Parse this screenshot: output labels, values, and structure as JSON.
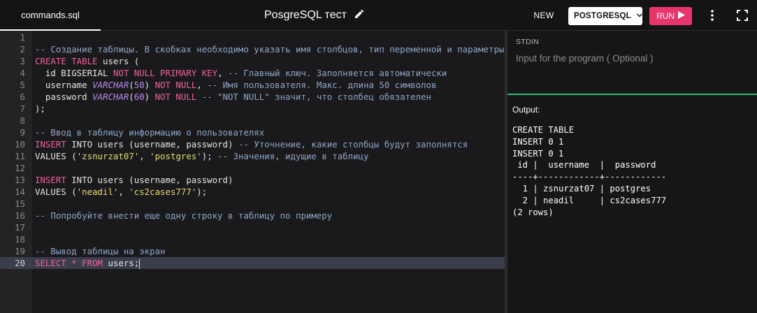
{
  "tab": {
    "label": "commands.sql"
  },
  "header": {
    "title": "PosgreSQL тест"
  },
  "toolbar": {
    "new_label": "NEW",
    "language": "POSTGRESQL",
    "run_label": "RUN"
  },
  "colors": {
    "run_button": "#e6366c",
    "divider_accent": "#2fbf7a",
    "active_line": "#3a3d4a"
  },
  "stdin": {
    "label": "STDIN",
    "placeholder": "Input for the program ( Optional )"
  },
  "output": {
    "label": "Output:",
    "text": "CREATE TABLE\nINSERT 0 1\nINSERT 0 1\n id |  username  |  password  \n----+------------+------------\n  1 | zsnurzat07 | postgres\n  2 | neadil     | cs2cases777\n(2 rows)"
  },
  "editor": {
    "active_line": 20,
    "lines": [
      {
        "n": "1",
        "tokens": []
      },
      {
        "n": "2",
        "tokens": [
          {
            "t": "-- Создание таблицы. В скобках необходимо указать имя столбцов, тип переменной и параметры",
            "c": "cm"
          }
        ]
      },
      {
        "n": "3",
        "tokens": [
          {
            "t": "CREATE TABLE",
            "c": "kw"
          },
          {
            "t": " users (",
            "c": ""
          }
        ]
      },
      {
        "n": "4",
        "tokens": [
          {
            "t": "  id BIGSERIAL ",
            "c": ""
          },
          {
            "t": "NOT NULL PRIMARY KEY",
            "c": "kw"
          },
          {
            "t": ", ",
            "c": ""
          },
          {
            "t": "-- Главный ключ. Заполняется автоматически",
            "c": "cm"
          }
        ]
      },
      {
        "n": "5",
        "tokens": [
          {
            "t": "  username ",
            "c": ""
          },
          {
            "t": "VARCHAR",
            "c": "ty"
          },
          {
            "t": "(",
            "c": ""
          },
          {
            "t": "50",
            "c": "num"
          },
          {
            "t": ") ",
            "c": ""
          },
          {
            "t": "NOT NULL",
            "c": "kw"
          },
          {
            "t": ", ",
            "c": ""
          },
          {
            "t": "-- Имя пользователя. Макс. длина 50 символов",
            "c": "cm"
          }
        ]
      },
      {
        "n": "6",
        "tokens": [
          {
            "t": "  password ",
            "c": ""
          },
          {
            "t": "VARCHAR",
            "c": "ty"
          },
          {
            "t": "(",
            "c": ""
          },
          {
            "t": "60",
            "c": "num"
          },
          {
            "t": ") ",
            "c": ""
          },
          {
            "t": "NOT NULL",
            "c": "kw"
          },
          {
            "t": " ",
            "c": ""
          },
          {
            "t": "-- \"NOT NULL\" значит, что столбец обязателен",
            "c": "cm"
          }
        ]
      },
      {
        "n": "7",
        "tokens": [
          {
            "t": ");",
            "c": ""
          }
        ]
      },
      {
        "n": "8",
        "tokens": []
      },
      {
        "n": "9",
        "tokens": [
          {
            "t": "-- Ввод в таблицу информацию о пользователях",
            "c": "cm"
          }
        ]
      },
      {
        "n": "10",
        "tokens": [
          {
            "t": "INSERT",
            "c": "kw"
          },
          {
            "t": " INTO users (username, password) ",
            "c": ""
          },
          {
            "t": "-- Уточнение, какие столбцы будут заполнятся",
            "c": "cm"
          }
        ]
      },
      {
        "n": "11",
        "tokens": [
          {
            "t": "VALUES (",
            "c": ""
          },
          {
            "t": "'zsnurzat07'",
            "c": "str"
          },
          {
            "t": ", ",
            "c": ""
          },
          {
            "t": "'postgres'",
            "c": "str"
          },
          {
            "t": "); ",
            "c": ""
          },
          {
            "t": "-- Значения, идущие в таблицу",
            "c": "cm"
          }
        ]
      },
      {
        "n": "12",
        "tokens": []
      },
      {
        "n": "13",
        "tokens": [
          {
            "t": "INSERT",
            "c": "kw"
          },
          {
            "t": " INTO users (username, password)",
            "c": ""
          }
        ]
      },
      {
        "n": "14",
        "tokens": [
          {
            "t": "VALUES (",
            "c": ""
          },
          {
            "t": "'neadil'",
            "c": "str"
          },
          {
            "t": ", ",
            "c": ""
          },
          {
            "t": "'cs2cases777'",
            "c": "str"
          },
          {
            "t": ");",
            "c": ""
          }
        ]
      },
      {
        "n": "15",
        "tokens": []
      },
      {
        "n": "16",
        "tokens": [
          {
            "t": "-- Попробуйте внести еще одну строку в таблицу по примеру",
            "c": "cm"
          }
        ]
      },
      {
        "n": "17",
        "tokens": []
      },
      {
        "n": "18",
        "tokens": []
      },
      {
        "n": "19",
        "tokens": [
          {
            "t": "-- Вывод таблицы на экран",
            "c": "cm"
          }
        ]
      },
      {
        "n": "20",
        "tokens": [
          {
            "t": "SELECT",
            "c": "kw"
          },
          {
            "t": " ",
            "c": ""
          },
          {
            "t": "*",
            "c": "op"
          },
          {
            "t": " ",
            "c": ""
          },
          {
            "t": "FROM",
            "c": "kw"
          },
          {
            "t": " users;",
            "c": ""
          }
        ]
      }
    ]
  }
}
